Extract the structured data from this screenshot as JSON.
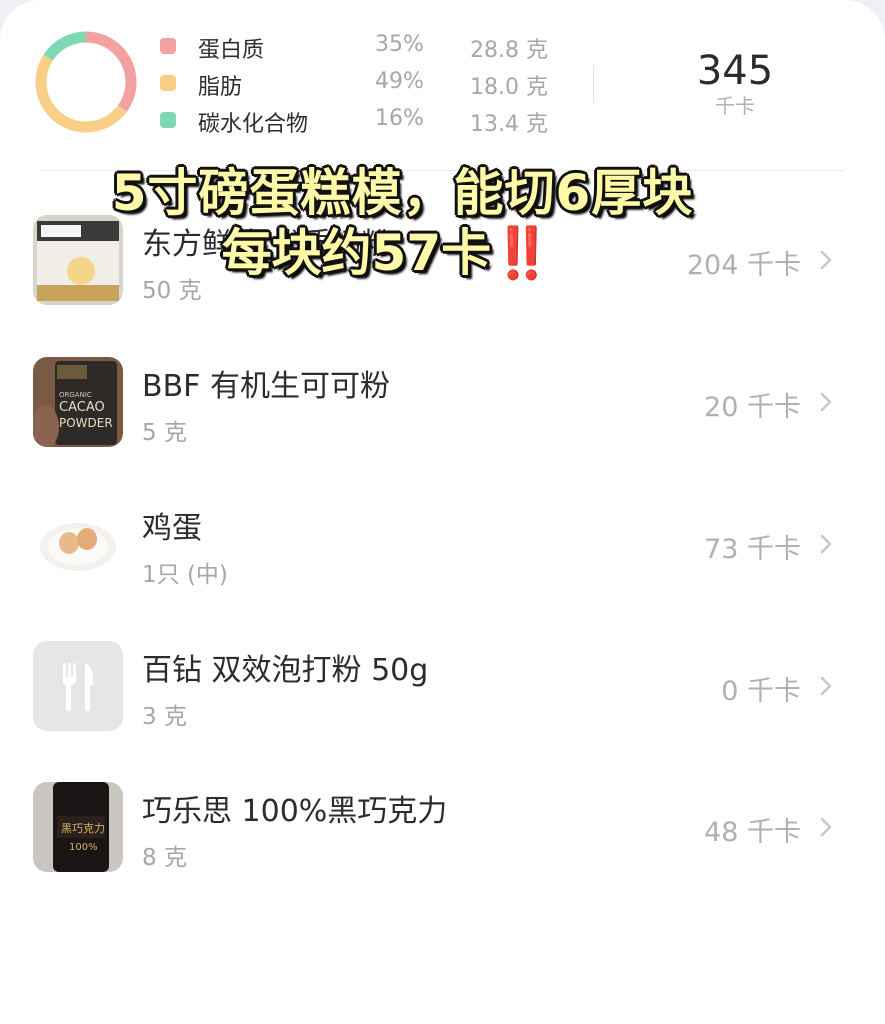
{
  "summary": {
    "macros": [
      {
        "name": "蛋白质",
        "percent": "35%",
        "grams": "28.8 克",
        "color": "#f2a0a0"
      },
      {
        "name": "脂肪",
        "percent": "49%",
        "grams": "18.0 克",
        "color": "#f8cf86"
      },
      {
        "name": "碳水化合物",
        "percent": "16%",
        "grams": "13.4 克",
        "color": "#7fd8b4"
      }
    ],
    "total_kcal": "345",
    "total_unit": "千卡"
  },
  "foods": [
    {
      "name": "东方鲜选 优质奶粉",
      "quantity": "50 克",
      "kcal": "204 千卡",
      "thumb": "milk-powder-bag-image"
    },
    {
      "name": "BBF 有机生可可粉",
      "quantity": "5 克",
      "kcal": "20 千卡",
      "thumb": "cacao-powder-pack-image",
      "thumb_text": [
        "ORGANIC",
        "CACAO",
        "POWDER"
      ]
    },
    {
      "name": "鸡蛋",
      "quantity": "1只 (中)",
      "kcal": "73 千卡",
      "thumb": "eggs-plate-image"
    },
    {
      "name": "百钻 双效泡打粉 50g",
      "quantity": "3 克",
      "kcal": "0 千卡",
      "thumb": "fork-knife-icon"
    },
    {
      "name": "巧乐思 100%黑巧克力",
      "quantity": "8 克",
      "kcal": "48 千卡",
      "thumb": "dark-chocolate-jar-image",
      "thumb_text": [
        "黑巧克力",
        "100%"
      ]
    }
  ],
  "caption": {
    "line1": "5寸磅蛋糕模，能切6厚块",
    "line2": "每块约57卡",
    "emoji": "‼️"
  }
}
